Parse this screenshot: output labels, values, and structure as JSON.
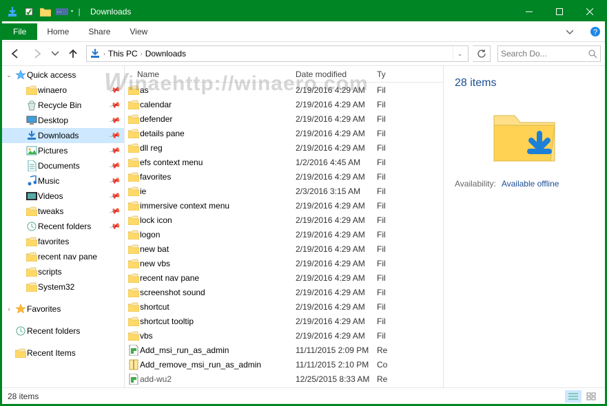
{
  "window": {
    "title": "Downloads"
  },
  "ribbon": {
    "file": "File",
    "tabs": [
      "Home",
      "Share",
      "View"
    ]
  },
  "breadcrumbs": [
    "This PC",
    "Downloads"
  ],
  "search": {
    "placeholder": "Search Do..."
  },
  "navpane": {
    "quick_access": {
      "label": "Quick access",
      "items": [
        {
          "label": "winaero",
          "icon": "folder",
          "pin": true
        },
        {
          "label": "Recycle Bin",
          "icon": "recycle",
          "pin": true
        },
        {
          "label": "Desktop",
          "icon": "desktop",
          "pin": true
        },
        {
          "label": "Downloads",
          "icon": "downloads",
          "pin": true,
          "selected": true
        },
        {
          "label": "Pictures",
          "icon": "pictures",
          "pin": true
        },
        {
          "label": "Documents",
          "icon": "documents",
          "pin": true
        },
        {
          "label": "Music",
          "icon": "music",
          "pin": true
        },
        {
          "label": "Videos",
          "icon": "videos",
          "pin": true
        },
        {
          "label": "tweaks",
          "icon": "folder",
          "pin": true
        },
        {
          "label": "Recent folders",
          "icon": "recent",
          "pin": true
        },
        {
          "label": "favorites",
          "icon": "folder",
          "pin": false
        },
        {
          "label": "recent nav pane",
          "icon": "folder",
          "pin": false
        },
        {
          "label": "scripts",
          "icon": "folder",
          "pin": false
        },
        {
          "label": "System32",
          "icon": "folder",
          "pin": false
        }
      ]
    },
    "favorites": {
      "label": "Favorites"
    },
    "recent_folders": {
      "label": "Recent folders"
    },
    "recent_items": {
      "label": "Recent Items"
    }
  },
  "columns": {
    "name": "Name",
    "date": "Date modified",
    "type": "Ty"
  },
  "files": [
    {
      "name": "as",
      "date": "2/19/2016 4:29 AM",
      "type": "Fil",
      "icon": "folder"
    },
    {
      "name": "calendar",
      "date": "2/19/2016 4:29 AM",
      "type": "Fil",
      "icon": "folder"
    },
    {
      "name": "defender",
      "date": "2/19/2016 4:29 AM",
      "type": "Fil",
      "icon": "folder"
    },
    {
      "name": "details pane",
      "date": "2/19/2016 4:29 AM",
      "type": "Fil",
      "icon": "folder"
    },
    {
      "name": "dll reg",
      "date": "2/19/2016 4:29 AM",
      "type": "Fil",
      "icon": "folder"
    },
    {
      "name": "efs context menu",
      "date": "1/2/2016 4:45 AM",
      "type": "Fil",
      "icon": "folder"
    },
    {
      "name": "favorites",
      "date": "2/19/2016 4:29 AM",
      "type": "Fil",
      "icon": "folder"
    },
    {
      "name": "ie",
      "date": "2/3/2016 3:15 AM",
      "type": "Fil",
      "icon": "folder"
    },
    {
      "name": "immersive context menu",
      "date": "2/19/2016 4:29 AM",
      "type": "Fil",
      "icon": "folder"
    },
    {
      "name": "lock icon",
      "date": "2/19/2016 4:29 AM",
      "type": "Fil",
      "icon": "folder"
    },
    {
      "name": "logon",
      "date": "2/19/2016 4:29 AM",
      "type": "Fil",
      "icon": "folder"
    },
    {
      "name": "new bat",
      "date": "2/19/2016 4:29 AM",
      "type": "Fil",
      "icon": "folder"
    },
    {
      "name": "new vbs",
      "date": "2/19/2016 4:29 AM",
      "type": "Fil",
      "icon": "folder"
    },
    {
      "name": "recent nav pane",
      "date": "2/19/2016 4:29 AM",
      "type": "Fil",
      "icon": "folder"
    },
    {
      "name": "screenshot sound",
      "date": "2/19/2016 4:29 AM",
      "type": "Fil",
      "icon": "folder"
    },
    {
      "name": "shortcut",
      "date": "2/19/2016 4:29 AM",
      "type": "Fil",
      "icon": "folder"
    },
    {
      "name": "shortcut tooltip",
      "date": "2/19/2016 4:29 AM",
      "type": "Fil",
      "icon": "folder"
    },
    {
      "name": "vbs",
      "date": "2/19/2016 4:29 AM",
      "type": "Fil",
      "icon": "folder"
    },
    {
      "name": "Add_msi_run_as_admin",
      "date": "11/11/2015 2:09 PM",
      "type": "Re",
      "icon": "reg"
    },
    {
      "name": "Add_remove_msi_run_as_admin",
      "date": "11/11/2015 2:10 PM",
      "type": "Co",
      "icon": "zip"
    },
    {
      "name": "add-wu2",
      "date": "12/25/2015 8:33 AM",
      "type": "Re",
      "icon": "reg",
      "cut": true
    }
  ],
  "details": {
    "count": "28 items",
    "availability_label": "Availability:",
    "availability_value": "Available offline"
  },
  "status": {
    "text": "28 items"
  }
}
